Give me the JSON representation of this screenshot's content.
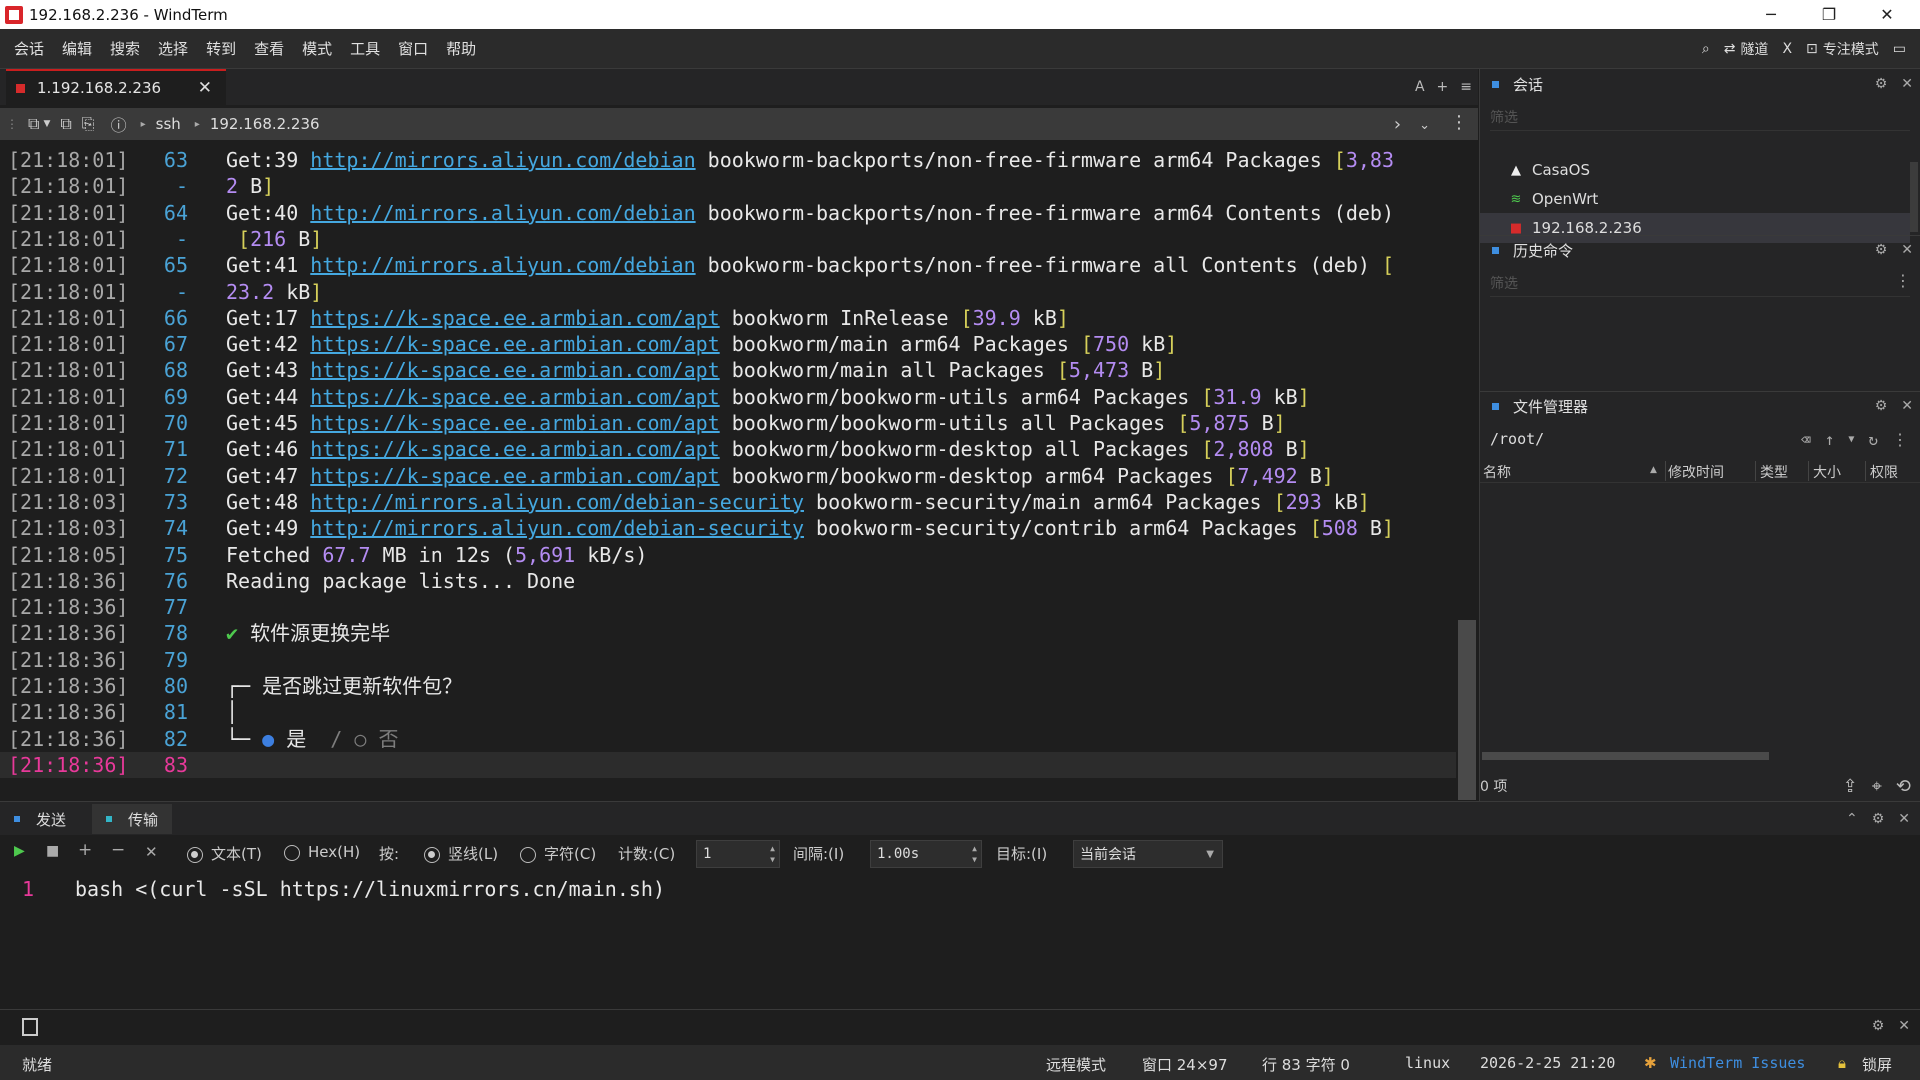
{
  "window": {
    "title": "192.168.2.236 - WindTerm"
  },
  "menu": [
    "会话",
    "编辑",
    "搜索",
    "选择",
    "转到",
    "查看",
    "模式",
    "工具",
    "窗口",
    "帮助"
  ],
  "menu_right": {
    "tunnel": "隧道",
    "x": "X",
    "focus_mode": "专注模式"
  },
  "tab": {
    "label": "1.192.168.2.236"
  },
  "tab_tools": {
    "font": "A",
    "add": "+",
    "more": "≡"
  },
  "path": {
    "protocol": "ssh",
    "host": "192.168.2.236"
  },
  "terminal": {
    "lines": [
      {
        "ts": "[21:18:01]",
        "ln": "63",
        "parts": [
          [
            "t",
            "Get:39 "
          ],
          [
            "link",
            "http://mirrors.aliyun.com/debian"
          ],
          [
            "t",
            " bookworm-backports/non-free-firmware arm64 Packages "
          ],
          [
            "br",
            "["
          ],
          [
            "num",
            "3,83"
          ]
        ]
      },
      {
        "ts": "[21:18:01]",
        "ln": "-",
        "parts": [
          [
            "num",
            "2"
          ],
          [
            "t",
            " B"
          ],
          [
            "br",
            "]"
          ]
        ]
      },
      {
        "ts": "[21:18:01]",
        "ln": "64",
        "parts": [
          [
            "t",
            "Get:40 "
          ],
          [
            "link",
            "http://mirrors.aliyun.com/debian"
          ],
          [
            "t",
            " bookworm-backports/non-free-firmware arm64 Contents (deb)"
          ]
        ]
      },
      {
        "ts": "[21:18:01]",
        "ln": "-",
        "parts": [
          [
            "t",
            " "
          ],
          [
            "br",
            "["
          ],
          [
            "num",
            "216"
          ],
          [
            "t",
            " B"
          ],
          [
            "br",
            "]"
          ]
        ]
      },
      {
        "ts": "[21:18:01]",
        "ln": "65",
        "parts": [
          [
            "t",
            "Get:41 "
          ],
          [
            "link",
            "http://mirrors.aliyun.com/debian"
          ],
          [
            "t",
            " bookworm-backports/non-free-firmware all Contents (deb) "
          ],
          [
            "br",
            "["
          ]
        ]
      },
      {
        "ts": "[21:18:01]",
        "ln": "-",
        "parts": [
          [
            "num",
            "23.2"
          ],
          [
            "t",
            " kB"
          ],
          [
            "br",
            "]"
          ]
        ]
      },
      {
        "ts": "[21:18:01]",
        "ln": "66",
        "parts": [
          [
            "t",
            "Get:17 "
          ],
          [
            "link",
            "https://k-space.ee.armbian.com/apt"
          ],
          [
            "t",
            " bookworm InRelease "
          ],
          [
            "br",
            "["
          ],
          [
            "num",
            "39.9"
          ],
          [
            "t",
            " kB"
          ],
          [
            "br",
            "]"
          ]
        ]
      },
      {
        "ts": "[21:18:01]",
        "ln": "67",
        "parts": [
          [
            "t",
            "Get:42 "
          ],
          [
            "link",
            "https://k-space.ee.armbian.com/apt"
          ],
          [
            "t",
            " bookworm/main arm64 Packages "
          ],
          [
            "br",
            "["
          ],
          [
            "num",
            "750"
          ],
          [
            "t",
            " kB"
          ],
          [
            "br",
            "]"
          ]
        ]
      },
      {
        "ts": "[21:18:01]",
        "ln": "68",
        "parts": [
          [
            "t",
            "Get:43 "
          ],
          [
            "link",
            "https://k-space.ee.armbian.com/apt"
          ],
          [
            "t",
            " bookworm/main all Packages "
          ],
          [
            "br",
            "["
          ],
          [
            "num",
            "5,473"
          ],
          [
            "t",
            " B"
          ],
          [
            "br",
            "]"
          ]
        ]
      },
      {
        "ts": "[21:18:01]",
        "ln": "69",
        "parts": [
          [
            "t",
            "Get:44 "
          ],
          [
            "link",
            "https://k-space.ee.armbian.com/apt"
          ],
          [
            "t",
            " bookworm/bookworm-utils arm64 Packages "
          ],
          [
            "br",
            "["
          ],
          [
            "num",
            "31.9"
          ],
          [
            "t",
            " kB"
          ],
          [
            "br",
            "]"
          ]
        ]
      },
      {
        "ts": "[21:18:01]",
        "ln": "70",
        "parts": [
          [
            "t",
            "Get:45 "
          ],
          [
            "link",
            "https://k-space.ee.armbian.com/apt"
          ],
          [
            "t",
            " bookworm/bookworm-utils all Packages "
          ],
          [
            "br",
            "["
          ],
          [
            "num",
            "5,875"
          ],
          [
            "t",
            " B"
          ],
          [
            "br",
            "]"
          ]
        ]
      },
      {
        "ts": "[21:18:01]",
        "ln": "71",
        "parts": [
          [
            "t",
            "Get:46 "
          ],
          [
            "link",
            "https://k-space.ee.armbian.com/apt"
          ],
          [
            "t",
            " bookworm/bookworm-desktop all Packages "
          ],
          [
            "br",
            "["
          ],
          [
            "num",
            "2,808"
          ],
          [
            "t",
            " B"
          ],
          [
            "br",
            "]"
          ]
        ]
      },
      {
        "ts": "[21:18:01]",
        "ln": "72",
        "parts": [
          [
            "t",
            "Get:47 "
          ],
          [
            "link",
            "https://k-space.ee.armbian.com/apt"
          ],
          [
            "t",
            " bookworm/bookworm-desktop arm64 Packages "
          ],
          [
            "br",
            "["
          ],
          [
            "num",
            "7,492"
          ],
          [
            "t",
            " B"
          ],
          [
            "br",
            "]"
          ]
        ]
      },
      {
        "ts": "[21:18:03]",
        "ln": "73",
        "parts": [
          [
            "t",
            "Get:48 "
          ],
          [
            "link",
            "http://mirrors.aliyun.com/debian-security"
          ],
          [
            "t",
            " bookworm-security/main arm64 Packages "
          ],
          [
            "br",
            "["
          ],
          [
            "num",
            "293"
          ],
          [
            "t",
            " kB"
          ],
          [
            "br",
            "]"
          ]
        ]
      },
      {
        "ts": "[21:18:03]",
        "ln": "74",
        "parts": [
          [
            "t",
            "Get:49 "
          ],
          [
            "link",
            "http://mirrors.aliyun.com/debian-security"
          ],
          [
            "t",
            " bookworm-security/contrib arm64 Packages "
          ],
          [
            "br",
            "["
          ],
          [
            "num",
            "508"
          ],
          [
            "t",
            " B"
          ],
          [
            "br",
            "]"
          ]
        ]
      },
      {
        "ts": "[21:18:05]",
        "ln": "75",
        "parts": [
          [
            "t",
            "Fetched "
          ],
          [
            "num",
            "67.7"
          ],
          [
            "t",
            " MB in 12s ("
          ],
          [
            "num",
            "5,691"
          ],
          [
            "t",
            " kB/s)"
          ]
        ]
      },
      {
        "ts": "[21:18:36]",
        "ln": "76",
        "parts": [
          [
            "t",
            "Reading package lists... Done"
          ]
        ]
      },
      {
        "ts": "[21:18:36]",
        "ln": "77",
        "parts": []
      },
      {
        "ts": "[21:18:36]",
        "ln": "78",
        "parts": [
          [
            "green",
            "✔"
          ],
          [
            "t",
            " 软件源更换完毕"
          ]
        ]
      },
      {
        "ts": "[21:18:36]",
        "ln": "79",
        "parts": []
      },
      {
        "ts": "[21:18:36]",
        "ln": "80",
        "parts": [
          [
            "t",
            "┌─ 是否跳过更新软件包？"
          ]
        ]
      },
      {
        "ts": "[21:18:36]",
        "ln": "81",
        "parts": [
          [
            "t",
            "│"
          ]
        ]
      },
      {
        "ts": "[21:18:36]",
        "ln": "82",
        "parts": [
          [
            "t",
            "└─ "
          ],
          [
            "bluedot",
            "●"
          ],
          [
            "t",
            " 是  "
          ],
          [
            "dim",
            "/"
          ],
          [
            "t",
            " "
          ],
          [
            "dim",
            "○ 否"
          ]
        ]
      },
      {
        "ts": "[21:18:36]",
        "ln": "83",
        "parts": [],
        "current": true
      }
    ]
  },
  "panels": {
    "sessions": {
      "title": "会话",
      "filter_placeholder": "筛选",
      "items": [
        {
          "label": "CasaOS",
          "icon": "linux-icon"
        },
        {
          "label": "OpenWrt",
          "icon": "wifi-icon"
        },
        {
          "label": "192.168.2.236",
          "icon": "ssh-session-icon"
        }
      ]
    },
    "history": {
      "title": "历史命令",
      "filter_placeholder": "筛选"
    },
    "files": {
      "title": "文件管理器",
      "path": "/root/",
      "columns": [
        "名称",
        "修改时间",
        "类型",
        "大小",
        "权限"
      ],
      "status": "0 项"
    }
  },
  "send": {
    "tabs": [
      "发送",
      "传输"
    ],
    "radio_text": "文本(T)",
    "radio_hex": "Hex(H)",
    "by_label": "按:",
    "radio_vline": "竖线(L)",
    "radio_char": "字符(C)",
    "count_label": "计数:(C)",
    "count_value": "1",
    "interval_label": "间隔:(I)",
    "interval_value": "1.00s",
    "target_label": "目标:(I)",
    "target_value": "当前会话",
    "line_no": "1",
    "command": "bash <(curl -sSL https://linuxmirrors.cn/main.sh)"
  },
  "status": {
    "ready": "就绪",
    "remote_mode": "远程模式",
    "window_size": "窗口 24×97",
    "line_col": "行 83 字符 0",
    "os": "linux",
    "datetime": "2026-2-25 21:20",
    "issues": "WindTerm Issues",
    "lock": "锁屏"
  },
  "colors": {
    "accent": "#3e8ee0",
    "link": "#45a8e0",
    "number": "#b48cf2",
    "bracket": "#d6d05a",
    "timestamp_current": "#e8399a"
  }
}
